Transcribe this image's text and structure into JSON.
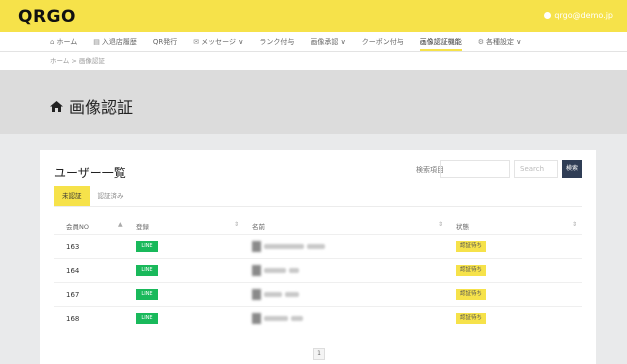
{
  "header": {
    "logo": "QRGO",
    "user_email": "qrgo@demo.jp"
  },
  "nav": {
    "items": [
      {
        "icon": "home-icon",
        "glyph": "⌂",
        "label": "ホーム"
      },
      {
        "icon": "people-icon",
        "glyph": "▤",
        "label": "入退店履歴"
      },
      {
        "icon": "qr-icon",
        "glyph": "",
        "label": "QR発行"
      },
      {
        "icon": "message-icon",
        "glyph": "✉",
        "label": "メッセージ ∨"
      },
      {
        "icon": "",
        "glyph": "",
        "label": "ランク付与"
      },
      {
        "icon": "",
        "glyph": "",
        "label": "画像承認 ∨"
      },
      {
        "icon": "",
        "glyph": "",
        "label": "クーポン付与"
      },
      {
        "icon": "",
        "glyph": "",
        "label": "画像認証機能"
      },
      {
        "icon": "settings-icon",
        "glyph": "⚙",
        "label": "各種設定 ∨"
      }
    ],
    "active_index": 7
  },
  "breadcrumb": "ホーム > 画像認証",
  "page": {
    "title": "画像認証"
  },
  "card": {
    "title": "ユーザー一覧",
    "search_label": "検索項目",
    "search_placeholder": "Search",
    "search_button": "検索",
    "tabs": [
      "未認証",
      "認証済み"
    ],
    "active_tab": 0,
    "columns": {
      "no": "会員NO",
      "sns": "登録",
      "name": "名前",
      "status": "状態"
    },
    "rows": [
      {
        "no": "163",
        "sns": "LINE",
        "status": "認証待ち"
      },
      {
        "no": "164",
        "sns": "LINE",
        "status": "認証待ち"
      },
      {
        "no": "167",
        "sns": "LINE",
        "status": "認証待ち"
      },
      {
        "no": "168",
        "sns": "LINE",
        "status": "認証待ち"
      }
    ],
    "page_number": "1"
  }
}
